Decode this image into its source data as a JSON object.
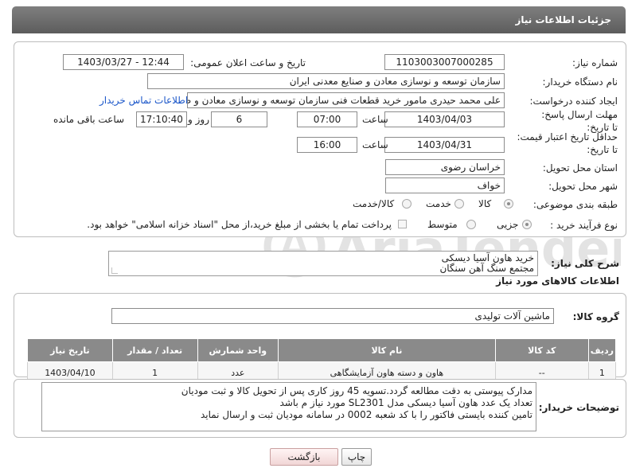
{
  "header": {
    "title": "جزئیات اطلاعات نیاز"
  },
  "fields": {
    "need_number_label": "شماره نیاز:",
    "need_number": "1103003007000285",
    "announce_label": "تاریخ و ساعت اعلان عمومی:",
    "announce_value": "1403/03/27 - 12:44",
    "buyer_org_label": "نام دستگاه خریدار:",
    "buyer_org": "سازمان توسعه و نوسازی معادن و صنایع معدنی ایران",
    "requester_label": "ایجاد کننده درخواست:",
    "requester": "علی محمد حیدری مامور خرید قطعات فنی سازمان توسعه و نوسازی معادن و ص",
    "contact_link": "اطلاعات تماس خریدار",
    "deadline_label": "مهلت ارسال پاسخ: تا تاریخ:",
    "deadline_date": "1403/04/03",
    "time_label": "ساعت",
    "deadline_time": "07:00",
    "days_value": "6",
    "days_label": "روز و",
    "remaining_time": "17:10:40",
    "remaining_label": "ساعت باقی مانده",
    "price_validity_label": "حداقل تاریخ اعتبار قیمت: تا تاریخ:",
    "price_validity_date": "1403/04/31",
    "price_validity_time": "16:00",
    "province_label": "استان محل تحویل:",
    "province": "خراسان رضوی",
    "city_label": "شهر محل تحویل:",
    "city": "خواف",
    "category_label": "طبقه بندی موضوعی:",
    "category_options": [
      "کالا",
      "خدمت",
      "کالا/خدمت"
    ],
    "process_label": "نوع فرآیند خرید :",
    "process_options": [
      "جزیی",
      "متوسط"
    ],
    "payment_note": "پرداخت تمام یا بخشی از مبلغ خرید،از محل \"اسناد خزانه اسلامی\" خواهد بود."
  },
  "summary": {
    "label": "شرح کلی نیاز:",
    "lines": [
      "خرید هاون آسیا دیسکی",
      "مجتمع سنگ آهن سنگان"
    ]
  },
  "goods": {
    "section_title": "اطلاعات کالاهای مورد نیاز",
    "group_label": "گروه کالا:",
    "group_value": "ماشین آلات تولیدی",
    "columns": [
      "ردیف",
      "کد کالا",
      "نام کالا",
      "واحد شمارش",
      "تعداد / مقدار",
      "تاریخ نیاز"
    ],
    "rows": [
      [
        "1",
        "--",
        "هاون و دسته هاون آزمایشگاهی",
        "عدد",
        "1",
        "1403/04/10"
      ]
    ]
  },
  "buyer_notes": {
    "label": "توضیحات خریدار:",
    "lines": [
      "مدارک پیوستی به دقت مطالعه گردد.تسویه 45 روز کاری پس از تحویل کالا و ثبت مودیان",
      "تعداد یک عدد هاون آسیا دیسکی مدل  SL2301  مورد نیاز م باشد",
      "تامین کننده بایستی فاکتور را با کد شعبه 0002 در سامانه مودیان ثبت و ارسال نماید"
    ]
  },
  "buttons": {
    "print": "چاپ",
    "back": "بازگشت"
  },
  "watermark": {
    "text": "AriaTender.neT"
  }
}
